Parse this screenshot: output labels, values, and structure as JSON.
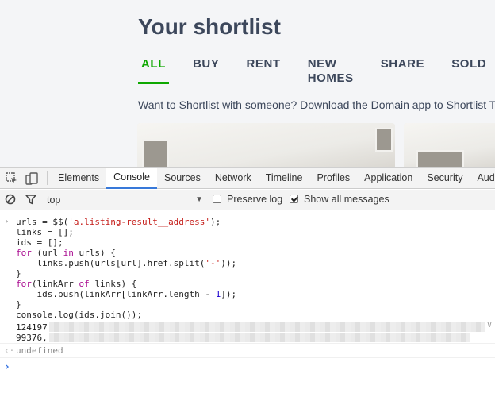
{
  "page": {
    "title": "Your shortlist",
    "tabs": [
      {
        "label": "ALL",
        "active": true
      },
      {
        "label": "BUY",
        "active": false
      },
      {
        "label": "RENT",
        "active": false
      },
      {
        "label": "NEW HOMES",
        "active": false
      },
      {
        "label": "SHARE",
        "active": false
      },
      {
        "label": "SOLD",
        "active": false
      }
    ],
    "promo_text": "Want to Shortlist with someone? Download the Domain app to Shortlist T",
    "accent_color": "#0ea800"
  },
  "devtools": {
    "tabs": [
      {
        "label": "Elements",
        "active": false
      },
      {
        "label": "Console",
        "active": true
      },
      {
        "label": "Sources",
        "active": false
      },
      {
        "label": "Network",
        "active": false
      },
      {
        "label": "Timeline",
        "active": false
      },
      {
        "label": "Profiles",
        "active": false
      },
      {
        "label": "Application",
        "active": false
      },
      {
        "label": "Security",
        "active": false
      },
      {
        "label": "Audits",
        "active": false
      }
    ],
    "icons": [
      "inspect-element-icon",
      "device-toolbar-icon",
      "clear-console-icon",
      "filter-icon"
    ],
    "context": "top",
    "preserve_log": {
      "label": "Preserve log",
      "checked": false
    },
    "show_all_messages": {
      "label": "Show all messages",
      "checked": true
    },
    "console": {
      "code_lines": [
        "urls = $$('a.listing-result__address');",
        "links = [];",
        "ids = [];",
        "for (url in urls) {",
        "    links.push(urls[url].href.split('-'));",
        "}",
        "for(linkArr of links) {",
        "    ids.push(linkArr[linkArr.length - 1]);",
        "}",
        "console.log(ids.join());"
      ],
      "output_lines": [
        "124197",
        "99376,"
      ],
      "output_source": "V",
      "return_value": "undefined"
    }
  }
}
